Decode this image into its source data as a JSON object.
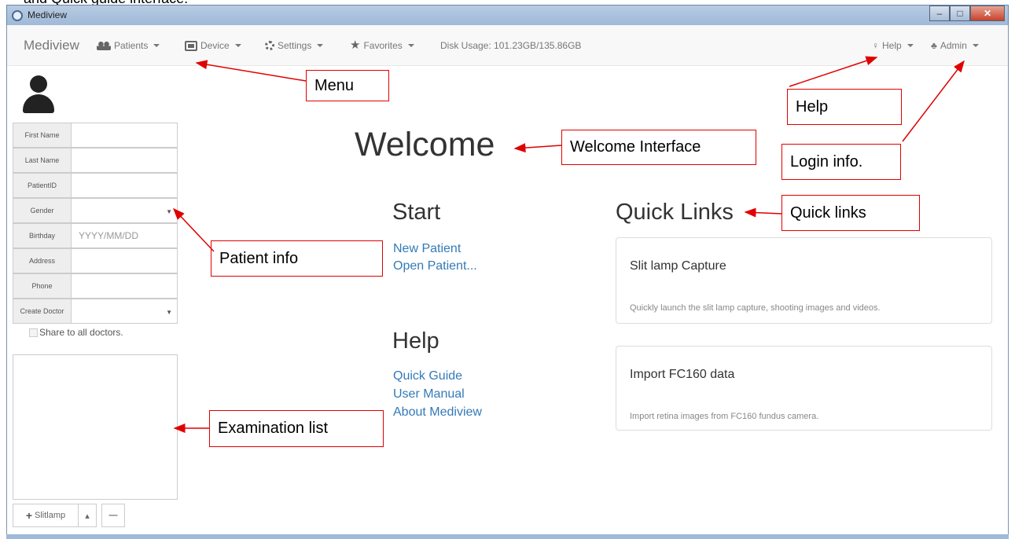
{
  "window": {
    "title": "Mediview"
  },
  "navbar": {
    "brand": "Mediview",
    "patients": "Patients",
    "device": "Device",
    "settings": "Settings",
    "favorites": "Favorites",
    "disk_usage": "Disk Usage: 101.23GB/135.86GB",
    "help": "Help",
    "admin": "Admin"
  },
  "patient_form": {
    "first_name": {
      "label": "First Name",
      "value": ""
    },
    "last_name": {
      "label": "Last Name",
      "value": ""
    },
    "patient_id": {
      "label": "PatientID",
      "value": ""
    },
    "gender": {
      "label": "Gender",
      "value": ""
    },
    "birthday": {
      "label": "Birthday",
      "placeholder": "YYYY/MM/DD"
    },
    "address": {
      "label": "Address",
      "value": ""
    },
    "phone": {
      "label": "Phone",
      "value": ""
    },
    "create_doctor": {
      "label": "Create Doctor",
      "value": ""
    },
    "share_label": "Share to all doctors."
  },
  "exam_buttons": {
    "add_label": "Slitlamp",
    "up_symbol": "▴",
    "remove_symbol": "—"
  },
  "main": {
    "welcome": "Welcome",
    "start": {
      "heading": "Start",
      "links": [
        "New Patient",
        "Open Patient..."
      ]
    },
    "help": {
      "heading": "Help",
      "links": [
        "Quick Guide",
        "User Manual",
        "About Mediview"
      ]
    },
    "quick_links": {
      "heading": "Quick Links",
      "cards": [
        {
          "title": "Slit lamp Capture",
          "desc": "Quickly launch the slit lamp capture, shooting images and videos."
        },
        {
          "title": "Import FC160 data",
          "desc": "Import retina images from FC160 fundus camera."
        }
      ]
    }
  },
  "annotations": {
    "menu": "Menu",
    "help": "Help",
    "login": "Login info.",
    "welcome": "Welcome Interface",
    "quick_links": "Quick links",
    "patient_info": "Patient info",
    "exam_list": "Examination list"
  },
  "colors": {
    "annotation_red": "#e00000",
    "link_blue": "#337ab7"
  },
  "icons": [
    "users-icon",
    "camera-icon",
    "gear-icon",
    "star-icon",
    "bulb-icon",
    "admin-icon",
    "user-avatar-icon",
    "plus-icon"
  ]
}
